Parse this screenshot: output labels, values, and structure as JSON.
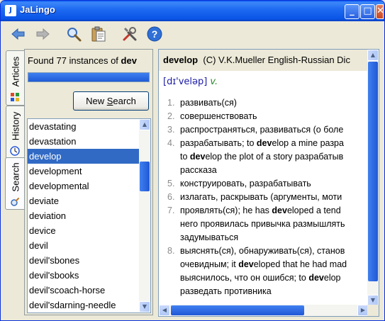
{
  "window": {
    "title": "JaLingo",
    "minimize": "_",
    "maximize": "□",
    "close": "✕"
  },
  "toolbar": {
    "buttons": [
      {
        "name": "back-arrow-icon"
      },
      {
        "name": "forward-arrow-icon"
      },
      {
        "name": "search-magnifier-icon"
      },
      {
        "name": "clipboard-icon"
      },
      {
        "name": "tools-icon"
      },
      {
        "name": "help-icon"
      }
    ]
  },
  "tabs": [
    {
      "label": "Articles",
      "icon": "articles-icon"
    },
    {
      "label": "History",
      "icon": "clock-icon"
    },
    {
      "label": "Search",
      "icon": "magnifier-icon",
      "active": true
    }
  ],
  "search": {
    "found_prefix": "Found 77 instances of ",
    "query": "dev",
    "progress": 1.0,
    "new_search_label": "New Search",
    "new_search_mnemonic_index": 4
  },
  "word_list": {
    "items": [
      "devastating",
      "devastation",
      "develop",
      "development",
      "developmental",
      "deviate",
      "deviation",
      "device",
      "devil",
      "devil'sbones",
      "devil'sbooks",
      "devil'scoach-horse",
      "devil'sdarning-needle"
    ],
    "selected_index": 2
  },
  "article": {
    "headword": "develop",
    "source": "(C) V.K.Mueller English-Russian Dic",
    "phonetic": "[dɪ'veləp]",
    "pos": "v.",
    "senses": [
      {
        "n": "1.",
        "lines": [
          [
            "развивать(ся)"
          ]
        ]
      },
      {
        "n": "2.",
        "lines": [
          [
            "совершенствовать"
          ]
        ]
      },
      {
        "n": "3.",
        "lines": [
          [
            "распространяться, развиваться (о боле"
          ]
        ]
      },
      {
        "n": "4.",
        "lines": [
          [
            "разрабатывать; to ",
            {
              "b": "dev"
            },
            "elop a mine разра"
          ],
          [
            "to ",
            {
              "b": "dev"
            },
            "elop the plot of a story разрабатыв"
          ],
          [
            "рассказа"
          ]
        ]
      },
      {
        "n": "5.",
        "lines": [
          [
            "конструировать, разрабатывать"
          ]
        ]
      },
      {
        "n": "6.",
        "lines": [
          [
            "излагать, раскрывать (аргументы, моти"
          ]
        ]
      },
      {
        "n": "7.",
        "lines": [
          [
            "проявлять(ся); he has ",
            {
              "b": "dev"
            },
            "eloped a tend"
          ],
          [
            "него проявилась привычка размышлять"
          ],
          [
            "задумываться"
          ]
        ]
      },
      {
        "n": "8.",
        "lines": [
          [
            "выяснять(ся), обнаруживать(ся), станов"
          ],
          [
            "очевидным; it ",
            {
              "b": "dev"
            },
            "eloped that he had mad"
          ],
          [
            "выяснилось, что он ошибся; to ",
            {
              "b": "dev"
            },
            "elop"
          ],
          [
            "разведать противника"
          ]
        ]
      }
    ]
  },
  "colors": {
    "titlebar": "#0a55e6",
    "selection": "#316ac5",
    "phonetic": "#1a1aa6",
    "pos": "#2a8a2a"
  }
}
